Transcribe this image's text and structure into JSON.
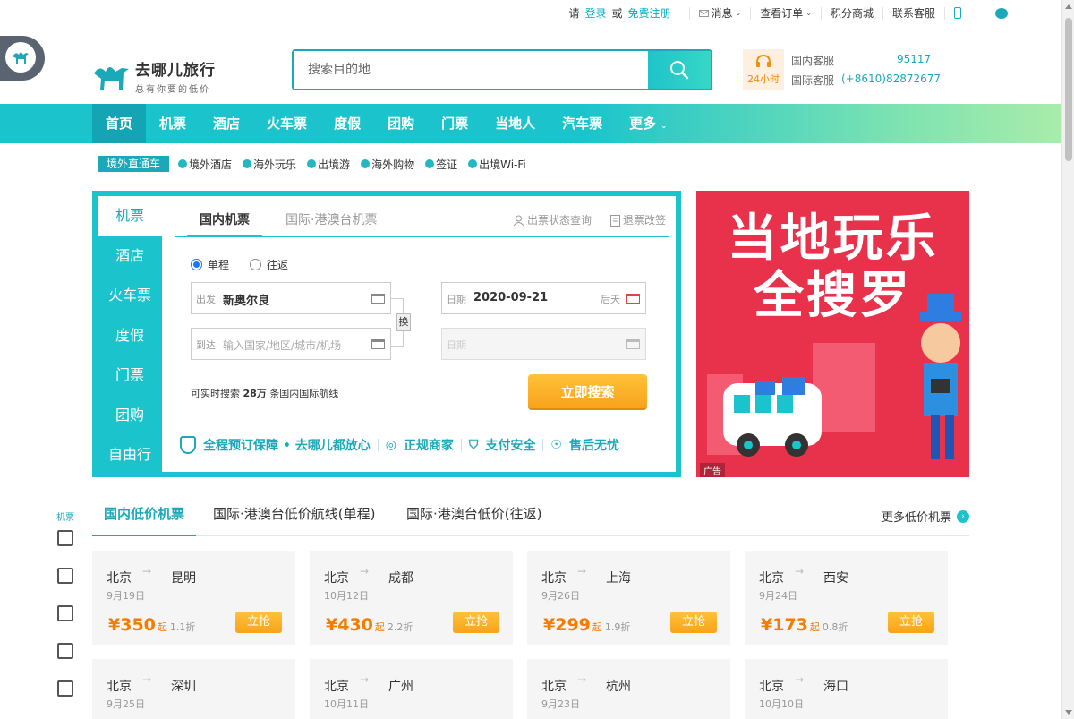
{
  "topbar": {
    "login_prefix": "请",
    "login": "登录",
    "or": "或",
    "register": "免费注册",
    "messages": "消息",
    "orders": "查看订单",
    "points_mall": "积分商城",
    "contact": "联系客服"
  },
  "header": {
    "brand": "去哪儿旅行",
    "slogan": "总有你要的低价",
    "search_placeholder": "搜索目的地",
    "service_badge": "24小时",
    "domestic_label": "国内客服",
    "domestic_phone": "95117",
    "intl_label": "国际客服",
    "intl_phone": "(+8610)82872677"
  },
  "nav": {
    "items": [
      "首页",
      "机票",
      "酒店",
      "火车票",
      "度假",
      "团购",
      "门票",
      "当地人",
      "汽车票",
      "更多"
    ]
  },
  "subnav": {
    "tag": "境外直通车",
    "links": [
      "境外酒店",
      "海外玩乐",
      "出境游",
      "海外购物",
      "签证",
      "出境Wi-Fi"
    ]
  },
  "booking": {
    "side_items": [
      "机票",
      "酒店",
      "火车票",
      "度假",
      "门票",
      "团购",
      "自由行"
    ],
    "tabs": [
      "国内机票",
      "国际·港澳台机票"
    ],
    "links": [
      "出票状态查询",
      "退票改签"
    ],
    "trip_types": [
      "单程",
      "往返"
    ],
    "depart_label": "出发",
    "depart_value": "新奥尔良",
    "arrive_label": "到达",
    "arrive_placeholder": "输入国家/地区/城市/机场",
    "swap": "换",
    "date_label": "日期",
    "date_value": "2020-09-21",
    "date_hint": "后天",
    "return_label": "日期",
    "stat_prefix": "可实时搜索",
    "stat_count": "28万",
    "stat_suffix": "条国内国际航线",
    "search_button": "立即搜索",
    "guarantees": [
      "全程预订保障 • 去哪儿都放心",
      "正规商家",
      "支付安全",
      "售后无忧"
    ]
  },
  "ad": {
    "line1": "当地玩乐",
    "line2": "全搜罗",
    "label": "广告"
  },
  "rail": {
    "label": "机票",
    "icons": [
      "hotel-icon",
      "vacation-icon",
      "ticket-icon",
      "book-icon",
      "guide-icon"
    ]
  },
  "lowprice": {
    "tabs": [
      "国内低价机票",
      "国际·港澳台低价航线(单程)",
      "国际·港澳台低价(往返)"
    ],
    "more": "更多低价机票",
    "buy_label": "立抢",
    "currency": "¥",
    "qi": "起",
    "cards": [
      {
        "from": "北京",
        "to": "昆明",
        "date": "9月19日",
        "price": "350",
        "discount": "1.1折"
      },
      {
        "from": "北京",
        "to": "成都",
        "date": "10月12日",
        "price": "430",
        "discount": "2.2折"
      },
      {
        "from": "北京",
        "to": "上海",
        "date": "9月26日",
        "price": "299",
        "discount": "1.9折"
      },
      {
        "from": "北京",
        "to": "西安",
        "date": "9月24日",
        "price": "173",
        "discount": "0.8折"
      },
      {
        "from": "北京",
        "to": "深圳",
        "date": "9月25日",
        "price": "",
        "discount": ""
      },
      {
        "from": "北京",
        "to": "广州",
        "date": "10月11日",
        "price": "",
        "discount": ""
      },
      {
        "from": "北京",
        "to": "杭州",
        "date": "9月23日",
        "price": "",
        "discount": ""
      },
      {
        "from": "北京",
        "to": "海口",
        "date": "10月10日",
        "price": "",
        "discount": ""
      }
    ]
  },
  "colors": {
    "brand": "#1bc4cc",
    "brand_dark": "#1ba9ba",
    "accent_orange": "#f8a31b",
    "ad_red": "#e8314b"
  }
}
